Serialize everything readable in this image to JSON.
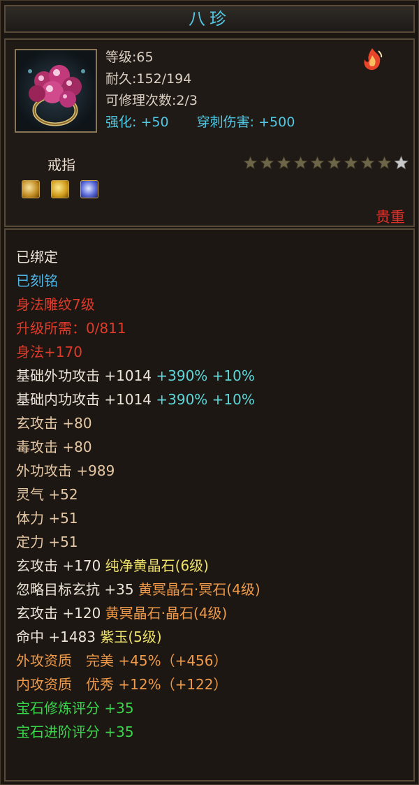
{
  "title": "八珍",
  "item": {
    "level": "等级:65",
    "durability": "耐久:152/194",
    "repairs": "可修理次数:2/3",
    "enhance_label": "强化:",
    "enhance_value": "+50",
    "pierce_label": "穿刺伤害:",
    "pierce_value": "+500",
    "type": "戒指",
    "rarity": "贵重",
    "stars_filled": 9,
    "stars_total": 10,
    "gems": [
      "gold-gem-icon",
      "gold-gem-icon",
      "blue-gem-icon"
    ]
  },
  "attributes": {
    "bound": "已绑定",
    "engraved": "已刻铭",
    "carving": "身法雕纹7级",
    "upgrade_req": "升级所需：0/811",
    "agility": "身法+170",
    "base_ext_atk": {
      "label": "基础外功攻击",
      "value": "+1014",
      "pct": "+390% +10%"
    },
    "base_int_atk": {
      "label": "基础内功攻击",
      "value": "+1014",
      "pct": "+390% +10%"
    },
    "xuan_atk1": "玄攻击 +80",
    "poison_atk": "毒攻击 +80",
    "ext_atk": "外功攻击 +989",
    "spirit": "灵气 +52",
    "stamina": "体力 +51",
    "focus": "定力 +51",
    "gem_line1": {
      "stat": "玄攻击 +170",
      "gem": "纯净黄晶石(6级)"
    },
    "gem_line2": {
      "stat": "忽略目标玄抗 +35",
      "gem": "黄冥晶石·冥石(4级)"
    },
    "gem_line3": {
      "stat": "玄攻击 +120",
      "gem": "黄冥晶石·晶石(4级)"
    },
    "gem_line4": {
      "stat": "命中 +1483",
      "gem": "紫玉(5级)"
    },
    "ext_quality": "外攻资质　完美 +45%（+456）",
    "int_quality": "内攻资质　优秀 +12%（+122）",
    "gem_refine_score": "宝石修炼评分 +35",
    "gem_advance_score": "宝石进阶评分 +35"
  },
  "colors": {
    "title": "#52c8e4",
    "rarity": "#e0302a",
    "green": "#38d64a",
    "orange": "#ee9a4a",
    "yellow": "#efe26a"
  }
}
